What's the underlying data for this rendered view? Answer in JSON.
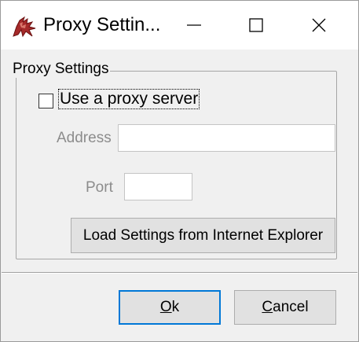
{
  "window": {
    "title": "Proxy Settin...",
    "icon": "red-dragon-app-icon",
    "controls": {
      "minimize": "minimize-icon",
      "maximize": "maximize-icon",
      "close": "close-icon"
    }
  },
  "group": {
    "label": "Proxy Settings"
  },
  "proxy_checkbox": {
    "label": "Use a proxy server",
    "checked": false
  },
  "address": {
    "label": "Address",
    "value": ""
  },
  "port": {
    "label": "Port",
    "value": ""
  },
  "buttons": {
    "load_settings": "Load Settings from Internet Explorer",
    "ok_mnemonic": "O",
    "ok_rest": "k",
    "cancel_mnemonic": "C",
    "cancel_rest": "ancel"
  },
  "colors": {
    "focus_border": "#0078d7",
    "dialog_background": "#f0f0f0",
    "disabled_text": "#8c8c8c"
  }
}
